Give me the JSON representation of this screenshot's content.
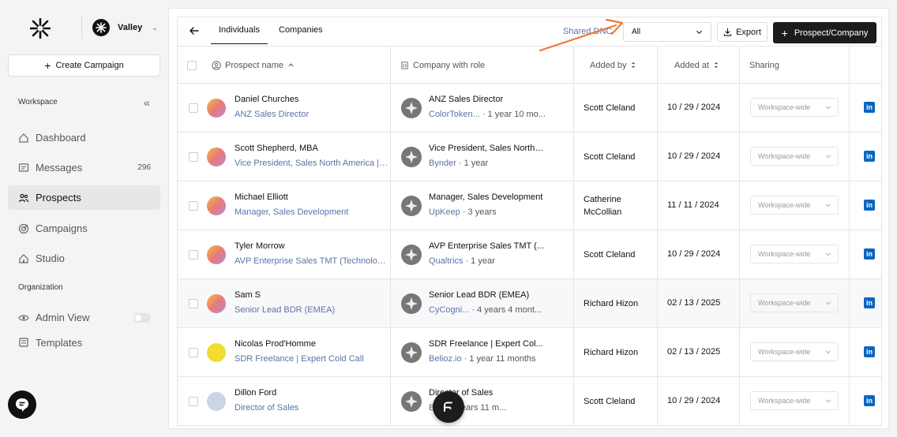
{
  "workspace": {
    "name": "Valley"
  },
  "sidebar": {
    "create_label": "Create Campaign",
    "section_workspace": "Workspace",
    "section_organization": "Organization",
    "items": [
      {
        "label": "Dashboard",
        "icon": "home-icon"
      },
      {
        "label": "Messages",
        "icon": "message-icon",
        "count": "296"
      },
      {
        "label": "Prospects",
        "icon": "people-icon",
        "active": true
      },
      {
        "label": "Campaigns",
        "icon": "target-icon"
      },
      {
        "label": "Studio",
        "icon": "home-icon"
      }
    ],
    "org_items": [
      {
        "label": "Admin View",
        "icon": "eye-icon"
      },
      {
        "label": "Templates",
        "icon": "template-icon"
      }
    ]
  },
  "toolbar": {
    "tabs": [
      "Individuals",
      "Companies"
    ],
    "dnc_label": "Shared DNC",
    "dnc_value": "All",
    "export_label": "Export",
    "primary_label": "Prospect/Company"
  },
  "columns": {
    "prospect": "Prospect name",
    "company": "Company with role",
    "added_by": "Added by",
    "added_at": "Added at",
    "sharing": "Sharing"
  },
  "rows": [
    {
      "name": "Daniel Churches",
      "title": "ANZ Sales Director",
      "role": "ANZ Sales Director",
      "company": "ColorToken...",
      "tenure": " · 1 year 10 mo...",
      "added_by": "Scott Cleland",
      "added_at": "10 / 29 / 2024",
      "sharing": "Workspace-wide"
    },
    {
      "name": "Scott Shepherd, MBA",
      "title": "Vice President, Sales North America | A...",
      "role": "Vice President, Sales North ...",
      "company": "Bynder",
      "tenure": " · 1 year",
      "added_by": "Scott Cleland",
      "added_at": "10 / 29 / 2024",
      "sharing": "Workspace-wide"
    },
    {
      "name": "Michael Elliott",
      "title": "Manager, Sales Development",
      "role": "Manager, Sales Development",
      "company": "UpKeep",
      "tenure": " · 3 years",
      "added_by": "Catherine McCollian",
      "added_at": "11 / 11 / 2024",
      "sharing": "Workspace-wide"
    },
    {
      "name": "Tyler Morrow",
      "title": "AVP Enterprise Sales TMT (Technology, ...",
      "role": "AVP Enterprise Sales TMT (...",
      "company": "Qualtrics",
      "tenure": " · 1 year",
      "added_by": "Scott Cleland",
      "added_at": "10 / 29 / 2024",
      "sharing": "Workspace-wide"
    },
    {
      "name": "Sam S",
      "title": "Senior Lead BDR (EMEA)",
      "role": "Senior Lead BDR (EMEA)",
      "company": "CyCogni...",
      "tenure": " · 4 years 4 mont...",
      "added_by": "Richard Hizon",
      "added_at": "02 / 13 / 2025",
      "sharing": "Workspace-wide"
    },
    {
      "name": "Nicolas Prod'Homme",
      "title": "SDR Freelance | Expert Cold Call",
      "role": "SDR Freelance | Expert Col...",
      "company": "Belioz.io",
      "tenure": " · 1 year 11 months",
      "added_by": "Richard Hizon",
      "added_at": "02 / 13 / 2025",
      "sharing": "Workspace-wide"
    },
    {
      "name": "Dillon Ford",
      "title": "Director of Sales",
      "role": "Director of Sales",
      "company": "B...",
      "tenure": " · 3 years 11 m...",
      "added_by": "Scott Cleland",
      "added_at": "10 / 29 / 2024",
      "sharing": "Workspace-wide"
    }
  ],
  "colors": {
    "accent": "#5a73a8",
    "primary": "#1c1c1c",
    "linkedin": "#0a66c2",
    "arrow": "#f07838"
  }
}
